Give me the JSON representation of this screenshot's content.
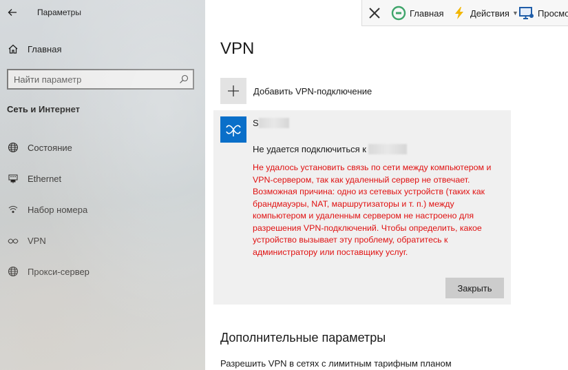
{
  "window": {
    "title": "Параметры"
  },
  "sidebar": {
    "home_label": "Главная",
    "search_placeholder": "Найти параметр",
    "section_title": "Сеть и Интернет",
    "items": [
      {
        "label": "Состояние",
        "icon": "globe-icon"
      },
      {
        "label": "Ethernet",
        "icon": "ethernet-icon"
      },
      {
        "label": "Набор номера",
        "icon": "dialup-icon"
      },
      {
        "label": "VPN",
        "icon": "vpn-icon"
      },
      {
        "label": "Прокси-сервер",
        "icon": "globe-icon"
      }
    ]
  },
  "toolbar": {
    "home_label": "Главная",
    "actions_label": "Действия",
    "view_label": "Просмо"
  },
  "main": {
    "page_title": "VPN",
    "add_vpn_label": "Добавить VPN-подключение",
    "connection": {
      "name_visible": "S",
      "status": "Не удается подключиться к",
      "error": "Не удалось установить связь по сети между компьютером и VPN-сервером, так как удаленный сервер не отвечает. Возможная причина: одно из сетевых устройств (таких как брандмауэры, NAT, маршрутизаторы и т. п.) между компьютером и удаленным сервером не настроено для разрешения VPN-подключений. Чтобы определить, какое устройство вызывает эту проблему, обратитесь к администратору или поставщику услуг.",
      "close_label": "Закрыть"
    },
    "more_title": "Дополнительные параметры",
    "metered_label": "Разрешить VPN в сетях с лимитным тарифным планом"
  },
  "colors": {
    "accent": "#0a6fc9",
    "error": "#e01010",
    "card_bg": "#f0f0f0"
  }
}
